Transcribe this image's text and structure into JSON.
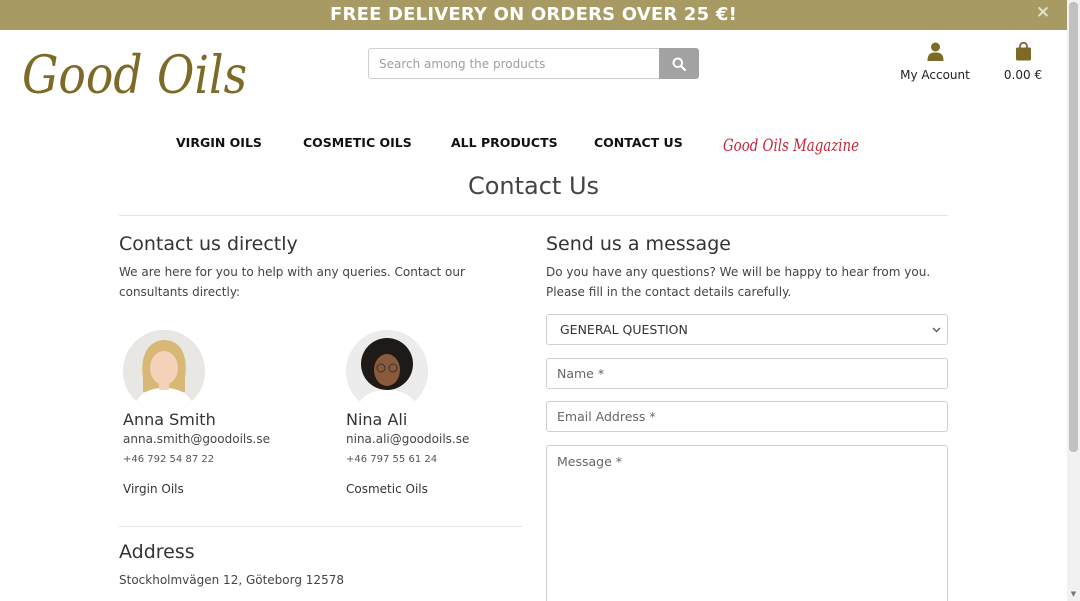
{
  "banner": {
    "text": "FREE DELIVERY ON ORDERS OVER 25 €!",
    "close_icon": "×"
  },
  "brand": {
    "logo_text": "Good Oils",
    "logo_color": "#7d6a27"
  },
  "search": {
    "placeholder": "Search among the products",
    "button_icon": "search-icon"
  },
  "header": {
    "account_label": "My Account",
    "cart_total": "0.00 €"
  },
  "nav": {
    "items": [
      "VIRGIN OILS",
      "COSMETIC OILS",
      "ALL PRODUCTS",
      "CONTACT US"
    ],
    "magazine_label": "Good Oils Magazine",
    "magazine_color": "#c8273b"
  },
  "page": {
    "title": "Contact Us"
  },
  "contact_direct": {
    "heading": "Contact us directly",
    "intro": "We are here for you to help with any queries. Contact our consultants directly:",
    "consultants": [
      {
        "name": "Anna Smith",
        "email": "anna.smith@goodoils.se",
        "phone": "+46 792 54 87 22",
        "department": "Virgin Oils"
      },
      {
        "name": "Nina Ali",
        "email": "nina.ali@goodoils.se",
        "phone": "+46 797 55 61 24",
        "department": "Cosmetic Oils"
      }
    ]
  },
  "address": {
    "heading": "Address",
    "line": "Stockholmvägen 12, Göteborg 12578"
  },
  "message_form": {
    "heading": "Send us a message",
    "intro": "Do you have any questions? We will be happy to hear from you. Please fill in the contact details carefully.",
    "subject_selected": "GENERAL QUESTION",
    "name_placeholder": "Name *",
    "email_placeholder": "Email Address *",
    "message_placeholder": "Message *"
  },
  "colors": {
    "banner_bg": "#a89a63",
    "accent_gold": "#7d6a27",
    "search_button_bg": "#a3a3a3"
  }
}
